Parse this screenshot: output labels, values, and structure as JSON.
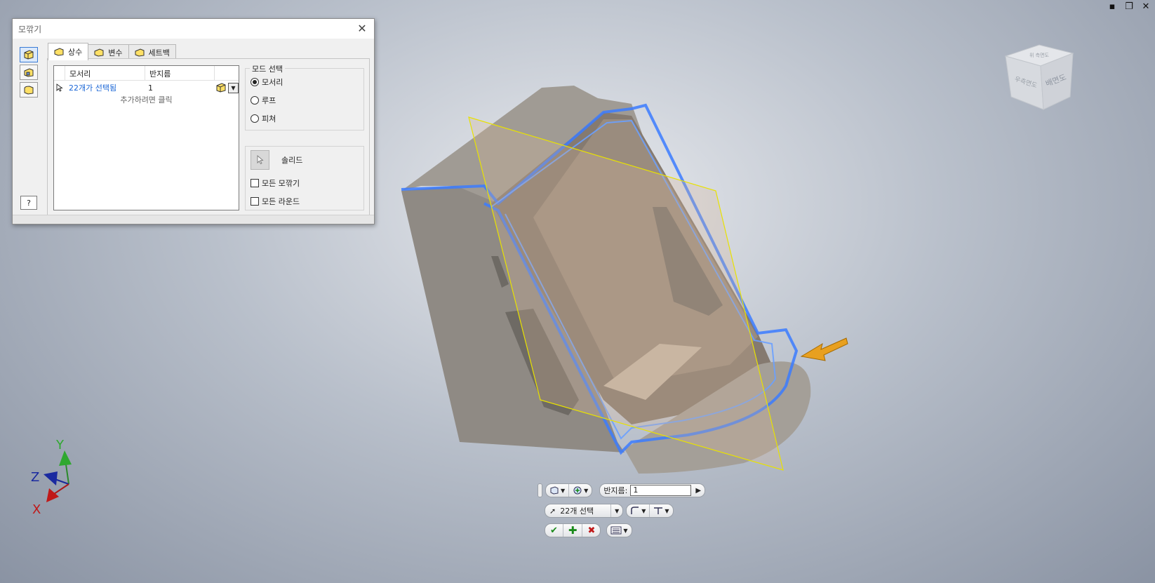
{
  "dialog": {
    "title": "모깎기",
    "tabs": [
      {
        "label": "상수"
      },
      {
        "label": "변수"
      },
      {
        "label": "세트백"
      }
    ],
    "grid": {
      "col_edge": "모서리",
      "col_radius": "반지름",
      "row": {
        "edges": "22개가 선택됨",
        "radius": "1"
      },
      "add_hint": "추가하려면 클릭"
    },
    "mode_group": {
      "legend": "모드 선택",
      "options": [
        {
          "label": "모서리",
          "selected": true
        },
        {
          "label": "루프",
          "selected": false
        },
        {
          "label": "피쳐",
          "selected": false
        }
      ]
    },
    "solid_group": {
      "solid_label": "솔리드",
      "all_fillets": "모든 모깎기",
      "all_rounds": "모든 라운드"
    },
    "help_label": "?"
  },
  "window_controls": {
    "minimize": "▪",
    "restore": "❐",
    "close": "✕"
  },
  "viewcube": {
    "top_label": "위 측면도",
    "right_label": "배면도",
    "front_label": "우측면도"
  },
  "triad": {
    "x": "X",
    "y": "Y",
    "z": "Z"
  },
  "minitoolbar": {
    "radius_label": "반지름:",
    "radius_value": "1",
    "selection_label": "22개 선택"
  },
  "colors": {
    "selection": "#3b7bff",
    "plane": "#e8e200",
    "accent_arrow": "#e8a020",
    "link": "#1a66d6"
  }
}
